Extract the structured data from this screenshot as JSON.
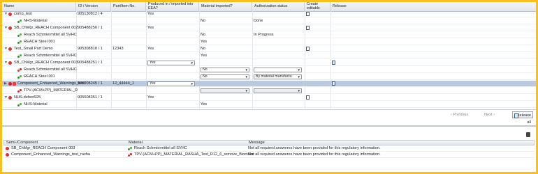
{
  "columns": {
    "name": "Name",
    "id_version": "ID / Version",
    "part_no": "Part/Item No.",
    "produced": "Produced in / imported into EEA?",
    "material_imported": "Material imported?",
    "authorization": "Authorization status",
    "create_version": "Create editable version",
    "release": "Release"
  },
  "rows": [
    {
      "name": "comp_test",
      "id": "905130812 / 4",
      "produced": "Yes"
    },
    {
      "name": "NHS-Material",
      "material_imported": "No",
      "authorization": "Done"
    },
    {
      "name": "SB_ChMgr_REACH Component 002",
      "id": "905488250 / 1",
      "produced": "Yes"
    },
    {
      "name": "Reach Schmiermittel all SVHC",
      "material_imported": "No",
      "authorization": "In Progress"
    },
    {
      "name": "REACH Steel 001",
      "material_imported": "Yes"
    },
    {
      "name": "Test_Small Part Demo",
      "id": "905308818 / 1",
      "part_no": "12343",
      "produced": "Yes",
      "material_imported": "No"
    },
    {
      "name": "Reach Schmiermittel all SVHC",
      "material_imported": "Yes"
    },
    {
      "name": "SB_ChMgr_REACH Component 003",
      "id": "905488251 / 1",
      "produced": "Yes"
    },
    {
      "name": "Reach Schmiermittel all SVHC",
      "material_imported": "No"
    },
    {
      "name": "REACH Steel 001",
      "material_imported": "No",
      "authorization": "By material manufactu"
    },
    {
      "name": "Component_Enhanced_Warnings_test",
      "id": "905908245 / 1",
      "part_no": "12_44444_1",
      "produced": "Yes"
    },
    {
      "name": "TPV-(ACM+PP)_MATERIAL_R"
    },
    {
      "name": "NHS-defect925",
      "id": "905508351 / 1",
      "produced": "Yes"
    },
    {
      "name": "NHS-Material",
      "material_imported": "Yes"
    }
  ],
  "pager": {
    "previous": "Previous",
    "next": "Next",
    "release_all": "Release all"
  },
  "lower": {
    "columns": {
      "semi": "Semi-/Component",
      "material": "Material",
      "message": "Message"
    },
    "rows": [
      {
        "semi": "SB_ChMgr_REACH Component 003",
        "material": "Reach Schmiermittel all SVHC",
        "message": "Not all required answeres have been provided for this regulatory information."
      },
      {
        "semi": "Component_Enhanced_Warnings_test_rasha",
        "material": "TPV-(ACM+PP)_MATERIAL_RASHA_Test_R12_6_remove_Biocides",
        "message": "Not all required answeres have been provided for this regulatory information."
      }
    ]
  }
}
